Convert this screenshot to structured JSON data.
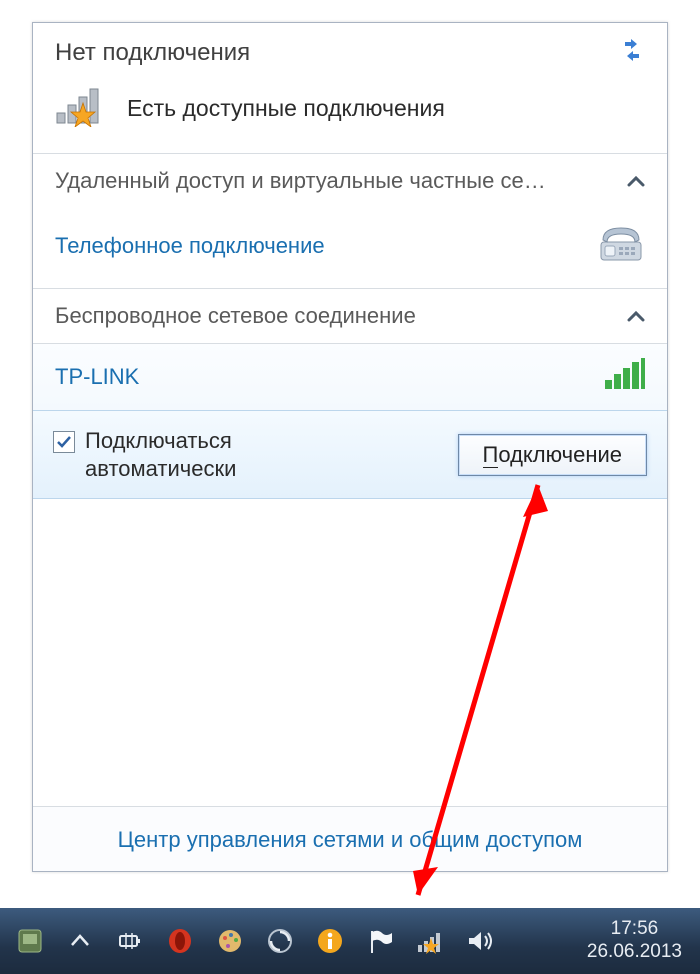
{
  "header": {
    "title": "Нет подключения"
  },
  "status": {
    "text": "Есть доступные подключения"
  },
  "sections": {
    "dialup_header": "Удаленный доступ и виртуальные частные се…",
    "dialup_item": "Телефонное подключение",
    "wireless_header": "Беспроводное сетевое соединение"
  },
  "wifi": {
    "ssid": "TP-LINK",
    "auto_label": "Подключаться автоматически",
    "connect_prefix": "П",
    "connect_suffix": "одключение"
  },
  "footer": {
    "link": "Центр управления сетями и общим доступом"
  },
  "taskbar": {
    "time": "17:56",
    "date": "26.06.2013"
  }
}
